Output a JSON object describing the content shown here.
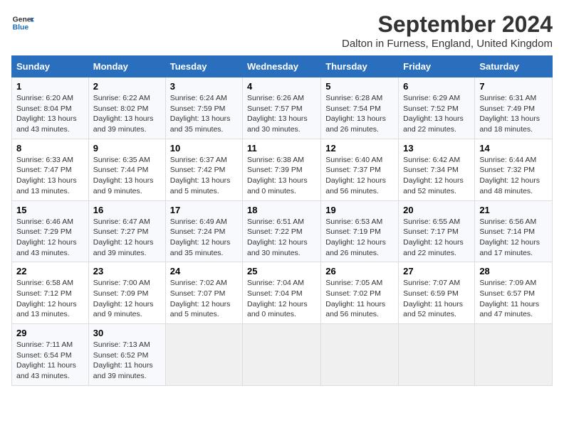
{
  "logo": {
    "line1": "General",
    "line2": "Blue"
  },
  "title": "September 2024",
  "subtitle": "Dalton in Furness, England, United Kingdom",
  "days_header": [
    "Sunday",
    "Monday",
    "Tuesday",
    "Wednesday",
    "Thursday",
    "Friday",
    "Saturday"
  ],
  "weeks": [
    [
      {
        "day": "1",
        "sunrise": "6:20 AM",
        "sunset": "8:04 PM",
        "daylight": "13 hours and 43 minutes."
      },
      {
        "day": "2",
        "sunrise": "6:22 AM",
        "sunset": "8:02 PM",
        "daylight": "13 hours and 39 minutes."
      },
      {
        "day": "3",
        "sunrise": "6:24 AM",
        "sunset": "7:59 PM",
        "daylight": "13 hours and 35 minutes."
      },
      {
        "day": "4",
        "sunrise": "6:26 AM",
        "sunset": "7:57 PM",
        "daylight": "13 hours and 30 minutes."
      },
      {
        "day": "5",
        "sunrise": "6:28 AM",
        "sunset": "7:54 PM",
        "daylight": "13 hours and 26 minutes."
      },
      {
        "day": "6",
        "sunrise": "6:29 AM",
        "sunset": "7:52 PM",
        "daylight": "13 hours and 22 minutes."
      },
      {
        "day": "7",
        "sunrise": "6:31 AM",
        "sunset": "7:49 PM",
        "daylight": "13 hours and 18 minutes."
      }
    ],
    [
      {
        "day": "8",
        "sunrise": "6:33 AM",
        "sunset": "7:47 PM",
        "daylight": "13 hours and 13 minutes."
      },
      {
        "day": "9",
        "sunrise": "6:35 AM",
        "sunset": "7:44 PM",
        "daylight": "13 hours and 9 minutes."
      },
      {
        "day": "10",
        "sunrise": "6:37 AM",
        "sunset": "7:42 PM",
        "daylight": "13 hours and 5 minutes."
      },
      {
        "day": "11",
        "sunrise": "6:38 AM",
        "sunset": "7:39 PM",
        "daylight": "13 hours and 0 minutes."
      },
      {
        "day": "12",
        "sunrise": "6:40 AM",
        "sunset": "7:37 PM",
        "daylight": "12 hours and 56 minutes."
      },
      {
        "day": "13",
        "sunrise": "6:42 AM",
        "sunset": "7:34 PM",
        "daylight": "12 hours and 52 minutes."
      },
      {
        "day": "14",
        "sunrise": "6:44 AM",
        "sunset": "7:32 PM",
        "daylight": "12 hours and 48 minutes."
      }
    ],
    [
      {
        "day": "15",
        "sunrise": "6:46 AM",
        "sunset": "7:29 PM",
        "daylight": "12 hours and 43 minutes."
      },
      {
        "day": "16",
        "sunrise": "6:47 AM",
        "sunset": "7:27 PM",
        "daylight": "12 hours and 39 minutes."
      },
      {
        "day": "17",
        "sunrise": "6:49 AM",
        "sunset": "7:24 PM",
        "daylight": "12 hours and 35 minutes."
      },
      {
        "day": "18",
        "sunrise": "6:51 AM",
        "sunset": "7:22 PM",
        "daylight": "12 hours and 30 minutes."
      },
      {
        "day": "19",
        "sunrise": "6:53 AM",
        "sunset": "7:19 PM",
        "daylight": "12 hours and 26 minutes."
      },
      {
        "day": "20",
        "sunrise": "6:55 AM",
        "sunset": "7:17 PM",
        "daylight": "12 hours and 22 minutes."
      },
      {
        "day": "21",
        "sunrise": "6:56 AM",
        "sunset": "7:14 PM",
        "daylight": "12 hours and 17 minutes."
      }
    ],
    [
      {
        "day": "22",
        "sunrise": "6:58 AM",
        "sunset": "7:12 PM",
        "daylight": "12 hours and 13 minutes."
      },
      {
        "day": "23",
        "sunrise": "7:00 AM",
        "sunset": "7:09 PM",
        "daylight": "12 hours and 9 minutes."
      },
      {
        "day": "24",
        "sunrise": "7:02 AM",
        "sunset": "7:07 PM",
        "daylight": "12 hours and 5 minutes."
      },
      {
        "day": "25",
        "sunrise": "7:04 AM",
        "sunset": "7:04 PM",
        "daylight": "12 hours and 0 minutes."
      },
      {
        "day": "26",
        "sunrise": "7:05 AM",
        "sunset": "7:02 PM",
        "daylight": "11 hours and 56 minutes."
      },
      {
        "day": "27",
        "sunrise": "7:07 AM",
        "sunset": "6:59 PM",
        "daylight": "11 hours and 52 minutes."
      },
      {
        "day": "28",
        "sunrise": "7:09 AM",
        "sunset": "6:57 PM",
        "daylight": "11 hours and 47 minutes."
      }
    ],
    [
      {
        "day": "29",
        "sunrise": "7:11 AM",
        "sunset": "6:54 PM",
        "daylight": "11 hours and 43 minutes."
      },
      {
        "day": "30",
        "sunrise": "7:13 AM",
        "sunset": "6:52 PM",
        "daylight": "11 hours and 39 minutes."
      },
      null,
      null,
      null,
      null,
      null
    ]
  ],
  "labels": {
    "sunrise": "Sunrise: ",
    "sunset": "Sunset: ",
    "daylight": "Daylight: "
  }
}
